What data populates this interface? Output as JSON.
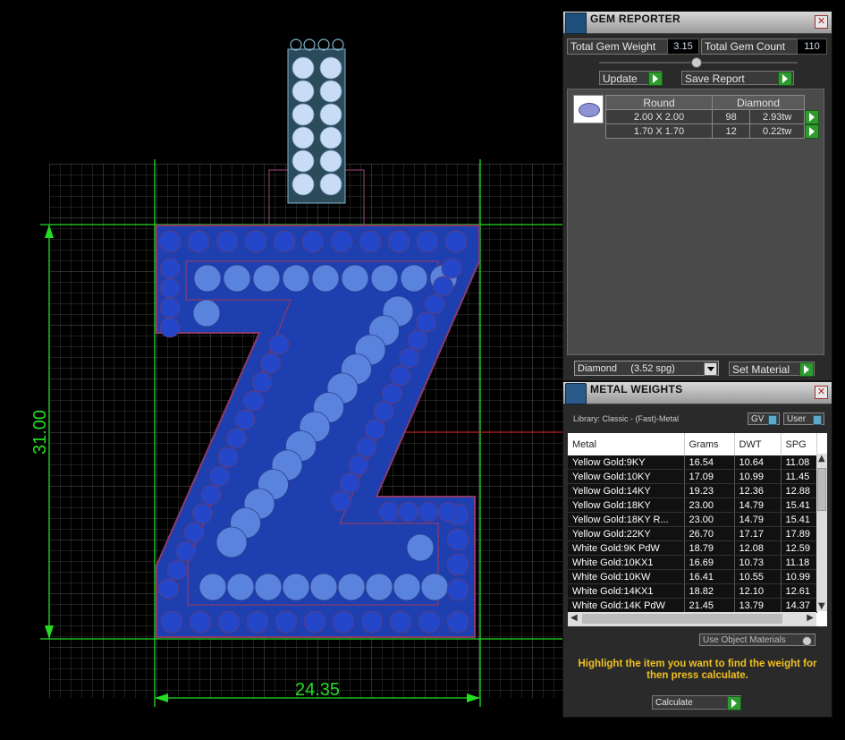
{
  "viewport": {
    "dimension_width": "24.35",
    "dimension_height": "31.00"
  },
  "gem_reporter": {
    "title": "GEM REPORTER",
    "total_weight_label": "Total Gem Weight",
    "total_weight_value": "3.15",
    "total_count_label": "Total Gem Count",
    "total_count_value": "110",
    "update_label": "Update",
    "save_report_label": "Save Report",
    "table": {
      "shape": "Round",
      "type": "Diamond",
      "rows": [
        {
          "size": "2.00 X 2.00",
          "count": "98",
          "weight": "2.93tw"
        },
        {
          "size": "1.70 X 1.70",
          "count": "12",
          "weight": "0.22tw"
        }
      ]
    },
    "material_select": "Diamond     (3.52 spg)",
    "set_material_label": "Set Material"
  },
  "metal_weights": {
    "title": "METAL WEIGHTS",
    "library": "Library: Classic - (Fast)-Metal",
    "gv_label": "GV",
    "user_label": "User",
    "columns": [
      "Metal",
      "Grams",
      "DWT",
      "SPG"
    ],
    "rows": [
      {
        "metal": "Yellow Gold:9KY",
        "grams": "16.54",
        "dwt": "10.64",
        "spg": "11.08"
      },
      {
        "metal": "Yellow Gold:10KY",
        "grams": "17.09",
        "dwt": "10.99",
        "spg": "11.45"
      },
      {
        "metal": "Yellow Gold:14KY",
        "grams": "19.23",
        "dwt": "12.36",
        "spg": "12.88"
      },
      {
        "metal": "Yellow Gold:18KY",
        "grams": "23.00",
        "dwt": "14.79",
        "spg": "15.41"
      },
      {
        "metal": "Yellow Gold:18KY R...",
        "grams": "23.00",
        "dwt": "14.79",
        "spg": "15.41"
      },
      {
        "metal": "Yellow Gold:22KY",
        "grams": "26.70",
        "dwt": "17.17",
        "spg": "17.89"
      },
      {
        "metal": "White Gold:9K PdW",
        "grams": "18.79",
        "dwt": "12.08",
        "spg": "12.59"
      },
      {
        "metal": "White Gold:10KX1",
        "grams": "16.69",
        "dwt": "10.73",
        "spg": "11.18"
      },
      {
        "metal": "White Gold:10KW",
        "grams": "16.41",
        "dwt": "10.55",
        "spg": "10.99"
      },
      {
        "metal": "White Gold:14KX1",
        "grams": "18.82",
        "dwt": "12.10",
        "spg": "12.61"
      },
      {
        "metal": "White Gold:14K PdW",
        "grams": "21.45",
        "dwt": "13.79",
        "spg": "14.37"
      }
    ],
    "use_object_materials_label": "Use Object Materials",
    "hint": "Highlight the item you want to find the weight for then press calculate.",
    "calculate_label": "Calculate"
  }
}
